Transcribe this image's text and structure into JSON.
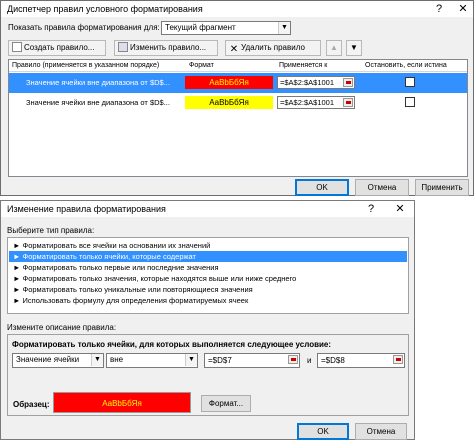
{
  "mgr": {
    "title": "Диспетчер правил условного форматирования",
    "show_rules_label": "Показать правила форматирования для:",
    "show_rules_value": "Текущий фрагмент",
    "btn_new": "Создать правило...",
    "btn_edit": "Изменить правило...",
    "btn_delete": "Удалить правило",
    "columns": [
      "Правило (применяется в указанном порядке)",
      "Формат",
      "Применяется к",
      "Остановить, если истина"
    ],
    "rows": [
      {
        "rule": "Значение ячейки вне диапазона от $D$...",
        "format": "АаВbБбЯя",
        "applies": "=$A$2:$A$1001",
        "color": "#ff0000",
        "text_color": "#ffff00"
      },
      {
        "rule": "Значение ячейки вне диапазона от $D$...",
        "format": "АаВbБбЯя",
        "applies": "=$A$2:$A$1001",
        "color": "#ffff00",
        "text_color": "#000000"
      }
    ],
    "ok": "OK",
    "cancel": "Отмена",
    "apply": "Применить"
  },
  "edit": {
    "title": "Изменение правила форматирования",
    "select_type_label": "Выберите тип правила:",
    "rule_types": [
      "► Форматировать все ячейки на основании их значений",
      "► Форматировать только ячейки, которые содержат",
      "► Форматировать только первые или последние значения",
      "► Форматировать только значения, которые находятся выше или ниже среднего",
      "► Форматировать только уникальные или повторяющиеся значения",
      "► Использовать формулу для определения форматируемых ячеек"
    ],
    "desc_label": "Измените описание правила:",
    "desc_heading": "Форматировать только ячейки, для которых выполняется следующее условие:",
    "cond_field": "Значение ячейки",
    "cond_op": "вне",
    "val1": "=$D$7",
    "and_label": "и",
    "val2": "=$D$8",
    "preview_label": "Образец:",
    "preview_text": "АаВbБбЯя",
    "preview_bg": "#ff0000",
    "preview_fg": "#ffff00",
    "format_btn": "Формат...",
    "ok": "OK",
    "cancel": "Отмена"
  },
  "icons": {
    "help": "?",
    "close": "✕",
    "up": "▲",
    "down": "▼"
  }
}
